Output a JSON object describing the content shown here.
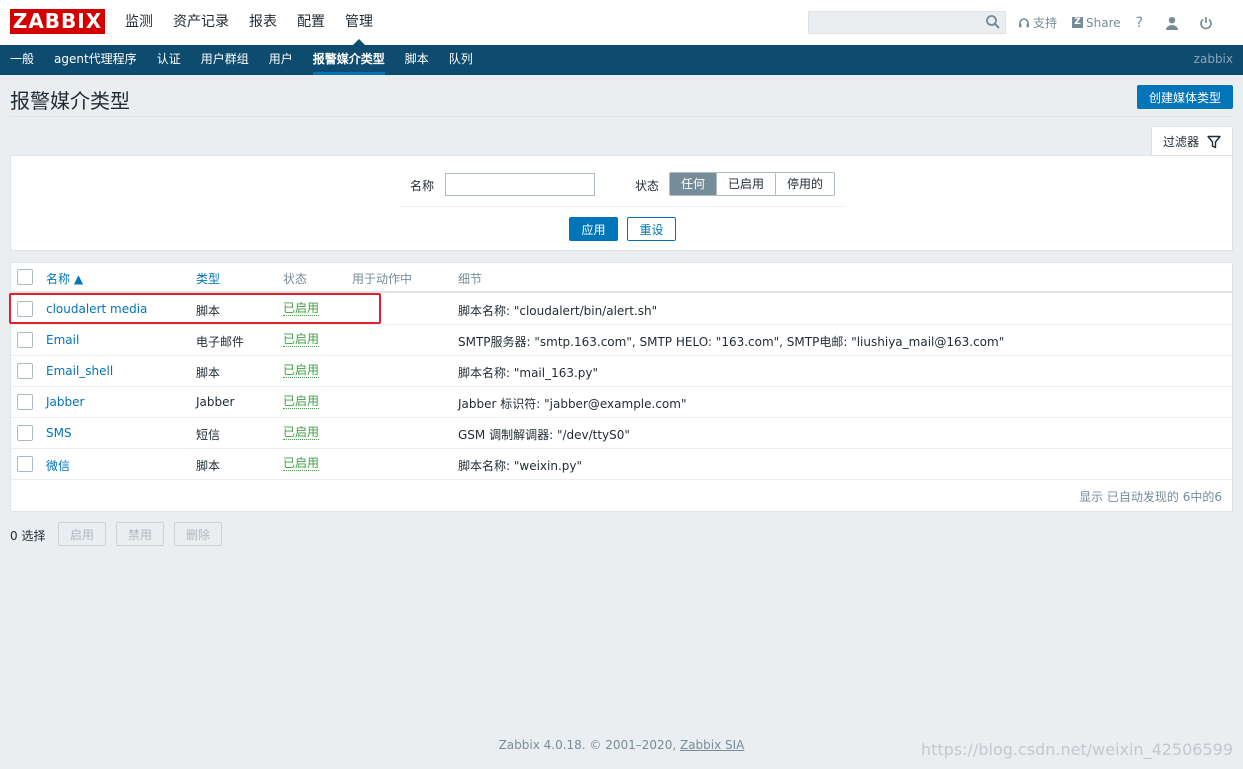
{
  "logo": "ZABBIX",
  "main_menu": [
    "监测",
    "资产记录",
    "报表",
    "配置",
    "管理"
  ],
  "main_menu_active": 4,
  "search": {
    "placeholder": "",
    "icon": "search-icon"
  },
  "top_tools": {
    "support": "支持",
    "share": "Share",
    "help": "?",
    "user_icon": "user-icon",
    "logout_icon": "power-icon"
  },
  "sub_menu": [
    "一般",
    "agent代理程序",
    "认证",
    "用户群组",
    "用户",
    "报警媒介类型",
    "脚本",
    "队列"
  ],
  "sub_menu_active": 5,
  "sub_user": "zabbix",
  "page_title": "报警媒介类型",
  "create_button": "创建媒体类型",
  "filter": {
    "tab_label": "过滤器",
    "name_label": "名称",
    "name_value": "",
    "status_label": "状态",
    "status_options": [
      "任何",
      "已启用",
      "停用的"
    ],
    "status_selected": 0,
    "apply": "应用",
    "reset": "重设"
  },
  "table": {
    "headers": {
      "name": "名称 ▲",
      "type": "类型",
      "status": "状态",
      "used": "用于动作中",
      "details": "细节"
    },
    "rows": [
      {
        "name": "cloudalert media",
        "type": "脚本",
        "status": "已启用",
        "details": "脚本名称: \"cloudalert/bin/alert.sh\""
      },
      {
        "name": "Email",
        "type": "电子邮件",
        "status": "已启用",
        "details": "SMTP服务器: \"smtp.163.com\", SMTP HELO: \"163.com\", SMTP电邮: \"liushiya_mail@163.com\""
      },
      {
        "name": "Email_shell",
        "type": "脚本",
        "status": "已启用",
        "details": "脚本名称: \"mail_163.py\""
      },
      {
        "name": "Jabber",
        "type": "Jabber",
        "status": "已启用",
        "details": "Jabber 标识符: \"jabber@example.com\""
      },
      {
        "name": "SMS",
        "type": "短信",
        "status": "已启用",
        "details": "GSM 调制解调器: \"/dev/ttyS0\""
      },
      {
        "name": "微信",
        "type": "脚本",
        "status": "已启用",
        "details": "脚本名称: \"weixin.py\""
      }
    ],
    "footer": "显示 已自动发现的 6中的6"
  },
  "bulk": {
    "selected": "0 选择",
    "enable": "启用",
    "disable": "禁用",
    "delete": "删除"
  },
  "footer": {
    "text": "Zabbix 4.0.18. © 2001–2020, ",
    "link": "Zabbix SIA"
  },
  "watermark": "https://blog.csdn.net/weixin_42506599",
  "colors": {
    "brand": "#d40000",
    "nav": "#0e4c6f",
    "accent": "#0275b8",
    "enabled": "#429e47",
    "highlight": "#e0202a"
  }
}
